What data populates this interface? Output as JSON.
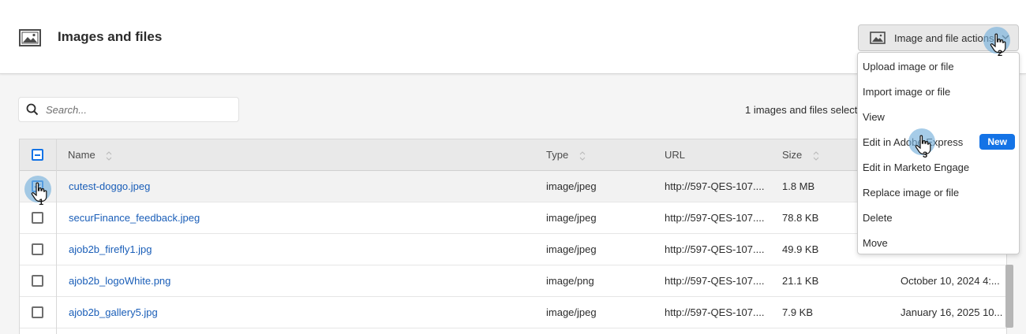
{
  "header": {
    "title": "Images and files",
    "page_icon": "image-icon",
    "actions_button_label": "Image and file actions"
  },
  "search": {
    "placeholder": "Search..."
  },
  "selection": {
    "count_text": "1 images and files selecte"
  },
  "table": {
    "columns": {
      "name": "Name",
      "type": "Type",
      "url": "URL",
      "size": "Size"
    },
    "rows": [
      {
        "name": "cutest-doggo.jpeg",
        "type": "image/jpeg",
        "url": "http://597-QES-107....",
        "size": "1.8 MB",
        "date": "",
        "checked": true
      },
      {
        "name": "securFinance_feedback.jpeg",
        "type": "image/jpeg",
        "url": "http://597-QES-107....",
        "size": "78.8 KB",
        "date": "",
        "checked": false
      },
      {
        "name": "ajob2b_firefly1.jpg",
        "type": "image/jpeg",
        "url": "http://597-QES-107....",
        "size": "49.9 KB",
        "date": "",
        "checked": false
      },
      {
        "name": "ajob2b_logoWhite.png",
        "type": "image/png",
        "url": "http://597-QES-107....",
        "size": "21.1 KB",
        "date": "October 10, 2024 4:...",
        "checked": false
      },
      {
        "name": "ajob2b_gallery5.jpg",
        "type": "image/jpeg",
        "url": "http://597-QES-107....",
        "size": "7.9 KB",
        "date": "January 16, 2025 10...",
        "checked": false
      }
    ]
  },
  "menu": {
    "items": [
      {
        "label": "Upload image or file"
      },
      {
        "label": "Import image or file"
      },
      {
        "label": "View"
      },
      {
        "label": "Edit in Adobe Express",
        "badge": "New"
      },
      {
        "label": "Edit in Marketo Engage"
      },
      {
        "label": "Replace image or file"
      },
      {
        "label": "Delete"
      },
      {
        "label": "Move"
      }
    ]
  },
  "step_markers": [
    "1",
    "2",
    "3"
  ],
  "colors": {
    "accent": "#1473e6",
    "link": "#1a5eb8",
    "marker": "#76b0dc"
  }
}
